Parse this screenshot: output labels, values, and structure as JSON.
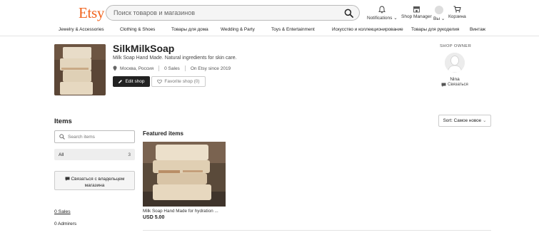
{
  "header": {
    "logo": "Etsy",
    "search_placeholder": "Поиск товаров и магазинов",
    "notifications_label": "Notifications",
    "shop_manager_label": "Shop Manager",
    "you_label": "Вы",
    "cart_label": "Корзина"
  },
  "categories": [
    "Jewelry & Accessories",
    "Clothing & Shoes",
    "Товары для дома",
    "Wedding & Party",
    "Toys & Entertainment",
    "Искусство и коллекционирование",
    "Товары для рукоделия",
    "Винтаж"
  ],
  "shop": {
    "name": "SilkMilkSoap",
    "tagline": "Milk Soap Hand Made. Natural ingredients for skin care.",
    "location": "Москва, Россия",
    "sales": "0 Sales",
    "since": "On Etsy since 2019",
    "edit_label": "Edit shop",
    "favorite_label": "Favorite shop (0)"
  },
  "owner": {
    "section_label": "SHOP OWNER",
    "name": "Nina",
    "contact_label": "Связаться"
  },
  "items": {
    "title": "Items",
    "search_placeholder": "Search items",
    "filter_all_label": "All",
    "filter_all_count": "3",
    "contact_owner_label": "Связаться с владельцем магазина",
    "sales_link": "0 Sales",
    "admirers": "0 Admirers",
    "sort_label": "Sort: Самое новое",
    "featured_title": "Featured items",
    "featured": [
      {
        "title": "Milk Soap Hand Made for hydration ...",
        "price": "USD 5.00"
      }
    ]
  },
  "colors": {
    "brand": "#f1641e",
    "dark_button": "#222222"
  }
}
